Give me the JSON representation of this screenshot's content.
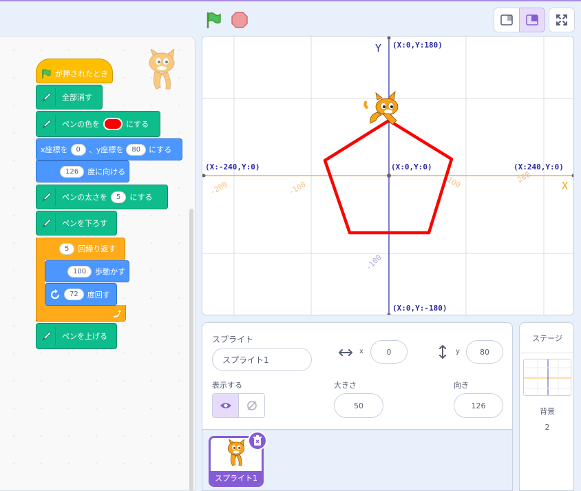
{
  "toolbar": {
    "green_flag": "green-flag-icon",
    "stop": "stop-icon",
    "layout_small": "small-stage-icon",
    "layout_large": "large-stage-icon",
    "fullscreen": "fullscreen-icon"
  },
  "code": {
    "hat_label": "が押されたとき",
    "clear_label": "全部消す",
    "set_color_pre": "ペンの色を",
    "set_color_post": "にする",
    "pen_color": "#ff0000",
    "goto_x_label": "x座標を",
    "goto_x_value": "0",
    "goto_y_label": "、y座標を",
    "goto_y_value": "80",
    "goto_post": "にする",
    "point_value": "126",
    "point_label": "度に向ける",
    "size_pre": "ペンの太さを",
    "size_value": "5",
    "size_post": "にする",
    "pen_down": "ペンを下ろす",
    "repeat_value": "5",
    "repeat_label": "回繰り返す",
    "move_value": "100",
    "move_label": "歩動かす",
    "turn_value": "72",
    "turn_label": "度回す",
    "pen_up": "ペンを上げる"
  },
  "stage": {
    "y_axis_label": "Y",
    "x_axis_label": "X",
    "top_label": "(X:0,Y:180)",
    "bottom_label": "(X:0,Y:-180)",
    "left_label": "(X:-240,Y:0)",
    "right_label": "(X:240,Y:0)",
    "center_label": "(X:0,Y:0)",
    "tick_m200": "-200",
    "tick_m100": "-100",
    "tick_100": "100",
    "tick_200": "200",
    "tick_y_m100": "-100",
    "pen_color": "#ff0000"
  },
  "sprite": {
    "section_label": "スプライト",
    "name": "スプライト1",
    "x_label": "x",
    "x_value": "0",
    "y_label": "y",
    "y_value": "80",
    "show_label": "表示する",
    "size_label": "大きさ",
    "size_value": "50",
    "direction_label": "向き",
    "direction_value": "126",
    "tile_label": "スプライト1"
  },
  "stage_panel": {
    "header": "ステージ",
    "backdrop_label": "背景",
    "backdrop_count": "2"
  }
}
